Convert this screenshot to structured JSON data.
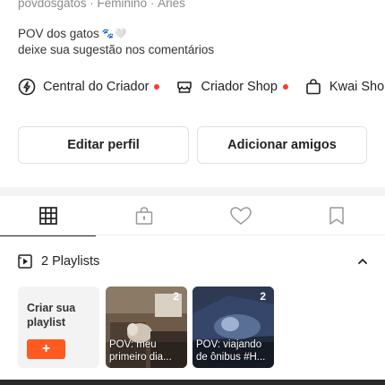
{
  "profile": {
    "meta": "povdosgatos · Feminino · Áries",
    "bio_line1": "POV dos gatos",
    "bio_emoji": "🐾🤍",
    "bio_line2": "deixe sua sugestão nos comentários"
  },
  "links": [
    {
      "label": "Central do Criador",
      "icon": "lightning-circle-icon",
      "dot": true
    },
    {
      "label": "Criador Shop",
      "icon": "store-icon",
      "dot": true
    },
    {
      "label": "Kwai Sho",
      "icon": "shopping-bag-icon",
      "dot": false
    }
  ],
  "actions": {
    "edit_label": "Editar perfil",
    "add_friends_label": "Adicionar amigos"
  },
  "tabs": [
    {
      "name": "grid",
      "icon": "grid-icon",
      "active": true
    },
    {
      "name": "private",
      "icon": "lock-bag-icon",
      "active": false
    },
    {
      "name": "liked",
      "icon": "heart-icon",
      "active": false
    },
    {
      "name": "saved",
      "icon": "bookmark-icon",
      "active": false
    }
  ],
  "playlists": {
    "header_label": "2 Playlists",
    "create_label": "Criar sua playlist",
    "create_button": "+",
    "items": [
      {
        "count": "2",
        "caption": "POV: meu primeiro dia..."
      },
      {
        "count": "2",
        "caption": "POV: viajando de ônibus #H..."
      }
    ]
  },
  "colors": {
    "accent": "#ff5a1f",
    "dot": "#ff3b30",
    "text": "#222222",
    "muted": "#8a8a8a"
  }
}
